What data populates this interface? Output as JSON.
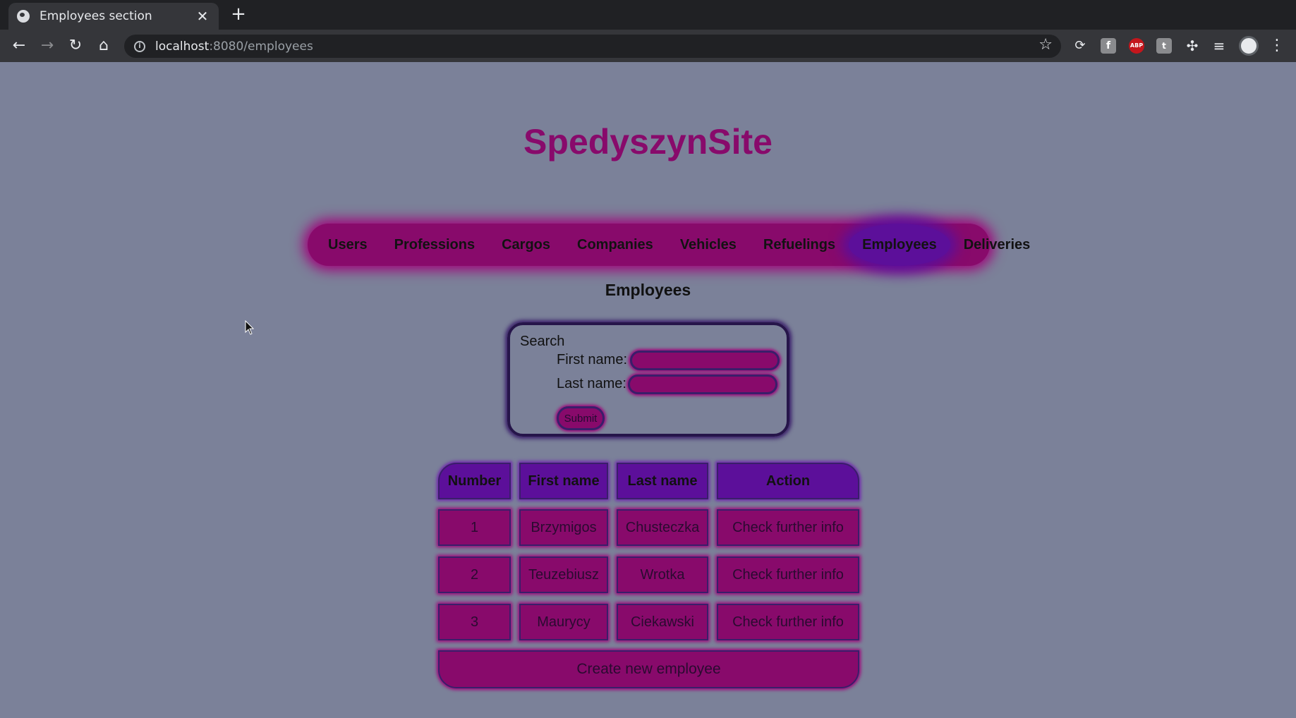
{
  "browser": {
    "tab_title": "Employees section",
    "tab_close": "✕",
    "new_tab": "+",
    "url_host": "localhost",
    "url_rest": ":8080/employees"
  },
  "site": {
    "title": "SpedyszynSite"
  },
  "nav": {
    "items": [
      "Users",
      "Professions",
      "Cargos",
      "Companies",
      "Vehicles",
      "Refuelings",
      "Employees",
      "Deliveries"
    ],
    "active": "Employees"
  },
  "section_title": "Employees",
  "search": {
    "legend": "Search",
    "first_name_label": "First name:",
    "last_name_label": "Last name:",
    "first_name_value": "",
    "last_name_value": "",
    "submit_label": "Submit"
  },
  "table": {
    "headers": [
      "Number",
      "First name",
      "Last name",
      "Action"
    ],
    "rows": [
      {
        "number": "1",
        "first_name": "Brzymigos",
        "last_name": "Chusteczka",
        "action": "Check further info"
      },
      {
        "number": "2",
        "first_name": "Teuzebiusz",
        "last_name": "Wrotka",
        "action": "Check further info"
      },
      {
        "number": "3",
        "first_name": "Maurycy",
        "last_name": "Ciekawski",
        "action": "Check further info"
      }
    ],
    "create_label": "Create new employee"
  },
  "colors": {
    "page_bg": "#7b8199",
    "accent": "#880a6b",
    "accent_active": "#5c0f9a",
    "border": "#3a1e6a"
  }
}
